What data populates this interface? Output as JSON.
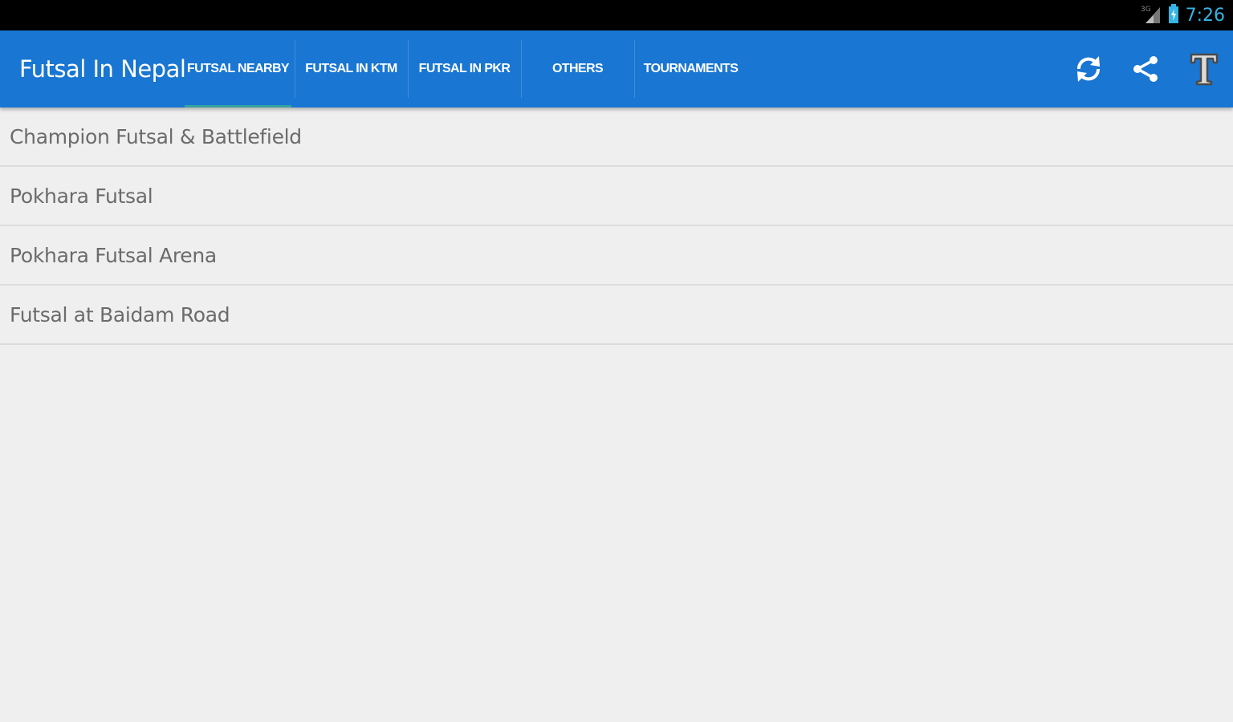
{
  "status_bar": {
    "time": "7:26",
    "time_color": "#33b5e5",
    "network_label": "3G",
    "icons": [
      "signal-icon",
      "battery-icon"
    ]
  },
  "app_bar": {
    "title": "Futsal In Nepal",
    "background_color": "#1976d2",
    "tabs": [
      {
        "label": "FUTSAL NEARBY",
        "selected": true
      },
      {
        "label": "FUTSAL IN KTM",
        "selected": false
      },
      {
        "label": "FUTSAL IN PKR",
        "selected": false
      },
      {
        "label": "OTHERS",
        "selected": false
      },
      {
        "label": "TOURNAMENTS",
        "selected": false
      }
    ],
    "actions": [
      "refresh-icon",
      "share-icon",
      "text-size-icon"
    ]
  },
  "list": {
    "items": [
      {
        "label": "Champion Futsal & Battlefield"
      },
      {
        "label": "Pokhara Futsal"
      },
      {
        "label": "Pokhara Futsal Arena"
      },
      {
        "label": "Futsal at Baidam Road"
      }
    ]
  }
}
